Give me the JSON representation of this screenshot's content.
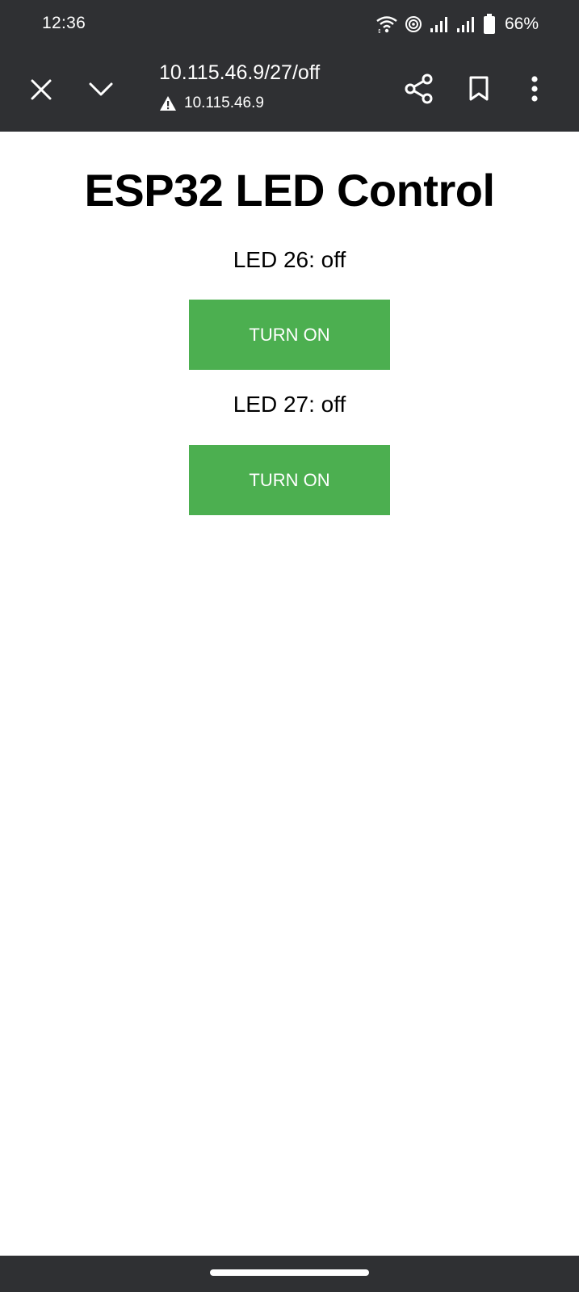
{
  "status_bar": {
    "time": "12:36",
    "battery": "66%",
    "icons": [
      "wifi-icon",
      "hotspot-icon",
      "signal-icon",
      "signal-icon",
      "battery-icon"
    ]
  },
  "toolbar": {
    "url_title": "10.115.46.9/27/off",
    "url_host": "10.115.46.9",
    "icons": [
      "close-icon",
      "chevron-down-icon",
      "warning-icon",
      "share-icon",
      "bookmark-icon",
      "more-vert-icon"
    ]
  },
  "page": {
    "title": "ESP32 LED Control",
    "leds": [
      {
        "label": "LED 26: off",
        "button": "TURN ON"
      },
      {
        "label": "LED 27: off",
        "button": "TURN ON"
      }
    ]
  },
  "colors": {
    "chrome": "#2f3033",
    "button": "#4caf50",
    "background": "#ffffff"
  }
}
